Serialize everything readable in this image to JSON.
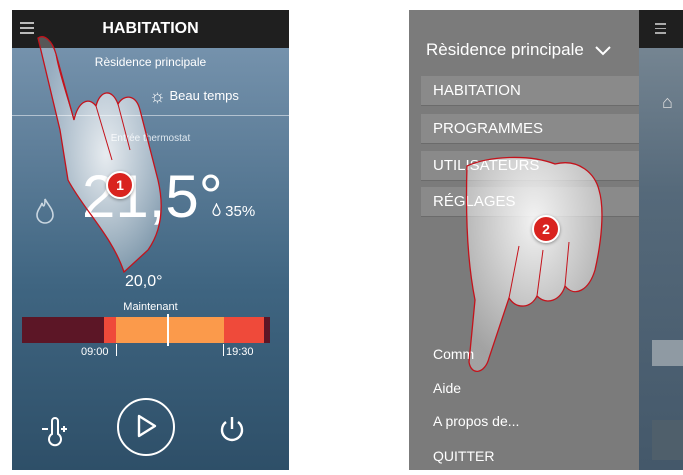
{
  "left_screen": {
    "title": "HABITATION",
    "home_name": "Rèsidence principale",
    "weather_label": "Beau temps",
    "thermostat_label": "Entrée thermostat",
    "temperature": "21,5°",
    "humidity": "35%",
    "setpoint": "20,0°",
    "now_label": "Maintenant",
    "time_start": "09:00",
    "time_end": "19:30",
    "step_badge": "1",
    "timeline_colors": [
      "#5c1626",
      "#ef4a3a",
      "#fb9a4b",
      "#ef4a3a",
      "#5c1626"
    ]
  },
  "right_screen": {
    "residence_select": "Rèsidence principale",
    "menu_items": [
      "HABITATION",
      "PROGRAMMES",
      "UTILISATEURS",
      "RÉGLAGES"
    ],
    "bottom_items": [
      "Comm",
      "Aide",
      "A propos de...",
      "QUITTER"
    ],
    "step_badge": "2"
  },
  "colors": {
    "badge_red": "#d9231f",
    "topbar": "#1f1f1f",
    "drawer_gray": "#7b7b7b"
  }
}
